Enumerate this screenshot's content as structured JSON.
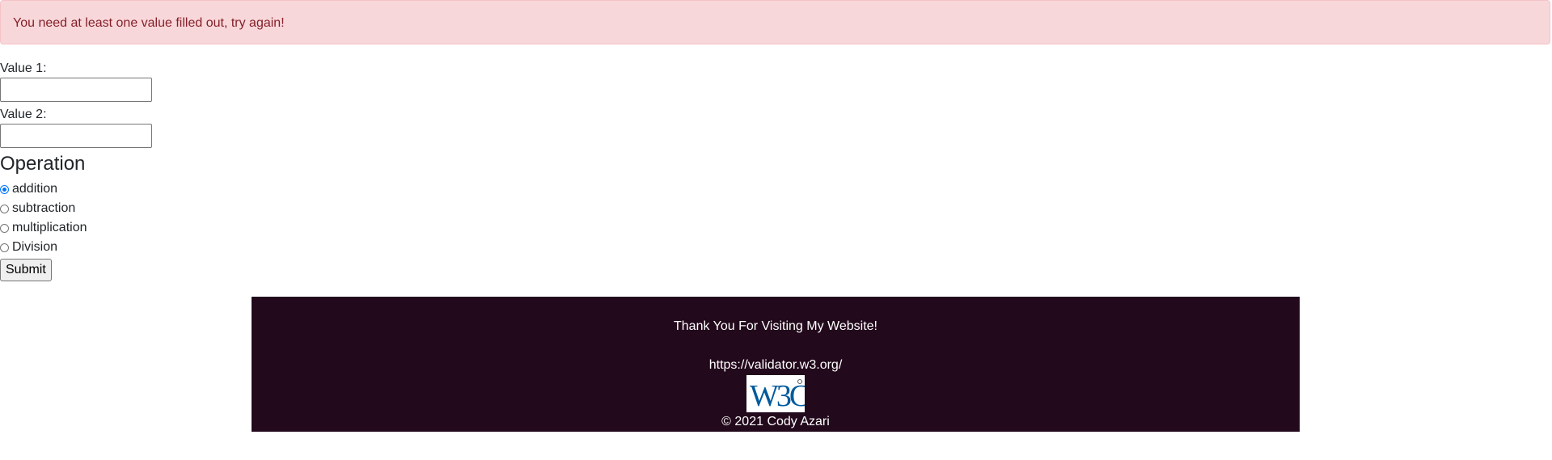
{
  "alert": {
    "message": "You need at least one value filled out, try again!"
  },
  "form": {
    "value1_label": "Value 1:",
    "value1": "",
    "value2_label": "Value 2:",
    "value2": "",
    "operation_heading": "Operation",
    "operations": [
      {
        "label": "addition",
        "checked": true
      },
      {
        "label": "subtraction",
        "checked": false
      },
      {
        "label": "multiplication",
        "checked": false
      },
      {
        "label": "Division",
        "checked": false
      }
    ],
    "submit_label": "Submit"
  },
  "footer": {
    "thanks": "Thank You For Visiting My Website!",
    "validator_link": "https://validator.w3.org/",
    "badge_text": "W3C",
    "copyright": "© 2021 Cody Azari"
  },
  "colors": {
    "alert_bg": "#f8d7da",
    "alert_text": "#842029",
    "footer_bg": "#22091c",
    "radio_accent": "#0075ff",
    "w3c_blue": "#005a9c"
  }
}
